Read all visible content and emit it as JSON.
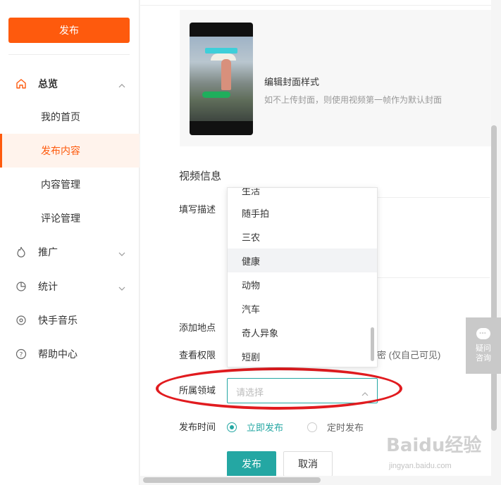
{
  "sidebar": {
    "publish_label": "发布",
    "overview": {
      "label": "总览",
      "icon": "home-icon"
    },
    "sub_items": [
      "我的首页",
      "发布内容",
      "内容管理",
      "评论管理"
    ],
    "active_sub": "发布内容",
    "items": [
      {
        "label": "推广",
        "icon": "flame-icon"
      },
      {
        "label": "统计",
        "icon": "pie-chart-icon"
      },
      {
        "label": "快手音乐",
        "icon": "music-disc-icon"
      },
      {
        "label": "帮助中心",
        "icon": "help-icon"
      }
    ],
    "accent_color": "#fe5a0d"
  },
  "cover": {
    "title": "编辑封面样式",
    "desc": "如不上传封面，则使用视频第一帧作为默认封面"
  },
  "form": {
    "section_title": "视频信息",
    "description_label": "填写描述",
    "location_label": "添加地点",
    "permission_label": "查看权限",
    "permission_tail": "密 (仅自己可见)",
    "domain_label": "所属领域",
    "domain_placeholder": "请选择",
    "time_label": "发布时间",
    "time_now": "立即发布",
    "time_scheduled": "定时发布",
    "submit_label": "发布",
    "cancel_label": "取消",
    "accent_color": "#24a7a3"
  },
  "dropdown": {
    "options": [
      "生活",
      "随手拍",
      "三农",
      "健康",
      "动物",
      "汽车",
      "奇人异象",
      "短剧"
    ],
    "hovered": "健康"
  },
  "consult": {
    "line1": "疑问",
    "line2": "咨询"
  },
  "watermark": {
    "brand": "Baidu经验",
    "url": "jingyan.baidu.com"
  }
}
